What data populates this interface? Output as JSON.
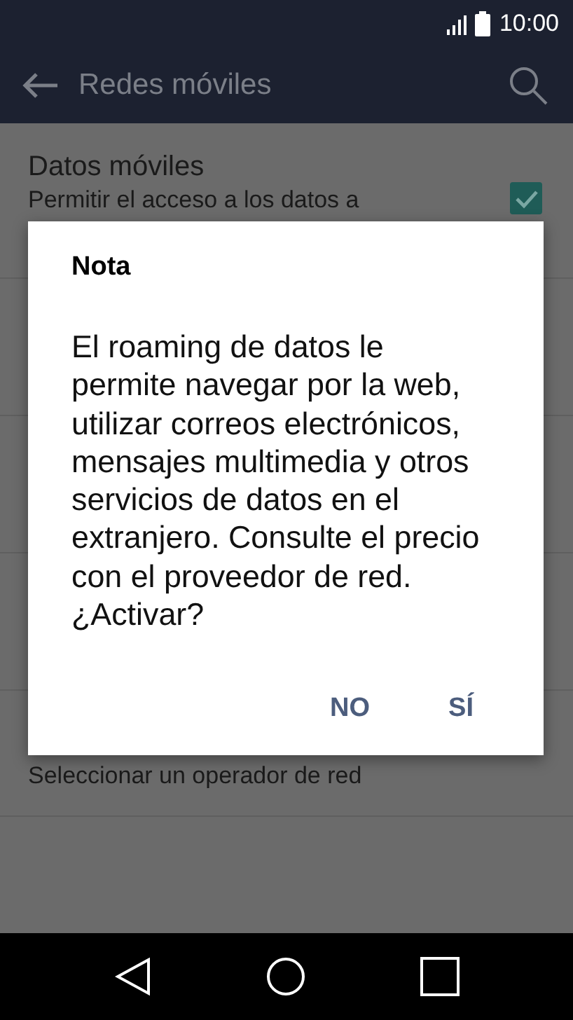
{
  "status_bar": {
    "time": "10:00"
  },
  "app_bar": {
    "title": "Redes móviles"
  },
  "settings": [
    {
      "title": "Datos móviles",
      "subtitle": "Permitir el acceso a los datos a",
      "kind": "checkbox",
      "checked": true
    },
    {
      "subtitle": "Seleccionar un operador de red",
      "kind": "plain"
    }
  ],
  "dialog": {
    "title": "Nota",
    "message": "El roaming de datos le permite navegar por la web, utilizar correos electrónicos, mensajes multimedia y otros servicios de datos en el extranjero. Consulte el precio con el proveedor de red. ¿Activar?",
    "buttons": [
      "NO",
      "SÍ"
    ]
  }
}
